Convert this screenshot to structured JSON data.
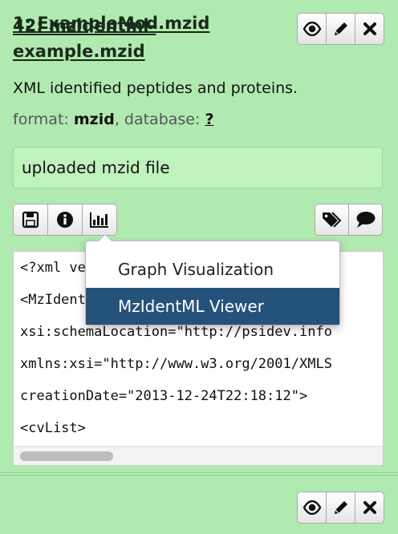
{
  "datasets": [
    {
      "title": "42: mzidentml-example.mzid",
      "info": "XML identified peptides and proteins.",
      "format_label": "format:",
      "format_value": "mzid",
      "database_label": ", database:",
      "database_value": "?",
      "annotation": "uploaded mzid file",
      "peek_lines": [
        "<?xml version=\"1.0\" encoding=\"UTF-8\"?>",
        "<MzIdentML id=\"\" version=\"1.1.0\"",
        "xsi:schemaLocation=\"http://psidev.info",
        "xmlns:xsi=\"http://www.w3.org/2001/XMLS",
        "creationDate=\"2013-12-24T22:18:12\">",
        "<cvList>"
      ]
    },
    {
      "title": "1: ExampleMod.mzid"
    }
  ],
  "icons": {
    "view": "eye-icon",
    "edit": "pencil-icon",
    "delete": "close-icon",
    "save": "floppy-disk-icon",
    "details": "info-icon",
    "visualize": "bar-chart-icon",
    "tags": "tags-icon",
    "comments": "comment-icon"
  },
  "visualize_menu": {
    "items": [
      {
        "label": "Graph Visualization",
        "active": false
      },
      {
        "label": "MzIdentML Viewer",
        "active": true
      }
    ]
  },
  "colors": {
    "dataset_bg": "#b0eab0",
    "menu_active_bg": "#24527a"
  }
}
